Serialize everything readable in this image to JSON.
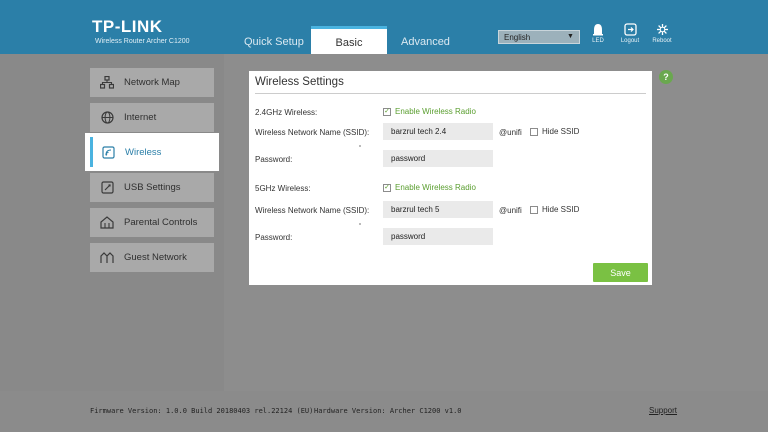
{
  "header": {
    "logo": "TP-LINK",
    "model": "Wireless Router Archer C1200",
    "tabs": [
      {
        "label": "Quick Setup"
      },
      {
        "label": "Basic"
      },
      {
        "label": "Advanced"
      }
    ],
    "language": "English",
    "icons": [
      {
        "name": "led-icon",
        "label": "LED"
      },
      {
        "name": "logout-icon",
        "label": "Logout"
      },
      {
        "name": "reboot-icon",
        "label": "Reboot"
      }
    ]
  },
  "sidebar": {
    "items": [
      {
        "label": "Network Map",
        "icon": "network-map-icon"
      },
      {
        "label": "Internet",
        "icon": "globe-icon"
      },
      {
        "label": "Wireless",
        "icon": "wireless-icon"
      },
      {
        "label": "USB Settings",
        "icon": "usb-icon"
      },
      {
        "label": "Parental Controls",
        "icon": "parental-icon"
      },
      {
        "label": "Guest Network",
        "icon": "guest-icon"
      }
    ],
    "active": "Wireless"
  },
  "panel": {
    "title": "Wireless Settings",
    "band24": {
      "label": "2.4GHz Wireless:",
      "enable_label": "Enable Wireless Radio",
      "ssid_label": "Wireless Network Name (SSID):",
      "ssid_value": "barzrul tech 2.4",
      "ssid_suffix": "@unifi",
      "hide_label": "Hide SSID",
      "password_label": "Password:",
      "password_value": "password"
    },
    "band5": {
      "label": "5GHz Wireless:",
      "enable_label": "Enable Wireless Radio",
      "ssid_label": "Wireless Network Name (SSID):",
      "ssid_value": "barzrul tech 5",
      "ssid_suffix": "@unifi",
      "hide_label": "Hide SSID",
      "password_label": "Password:",
      "password_value": "password"
    },
    "save_label": "Save",
    "help": "?"
  },
  "footer": {
    "firmware": "Firmware Version: 1.0.0 Build 20180403 rel.22124 (EU)",
    "hardware": "Hardware Version: Archer C1200 v1.0",
    "support": "Support"
  },
  "colors": {
    "header": "#2b7fa8",
    "accent": "#4ab3e0",
    "save": "#7ac143",
    "check": "#5a9e2f"
  }
}
